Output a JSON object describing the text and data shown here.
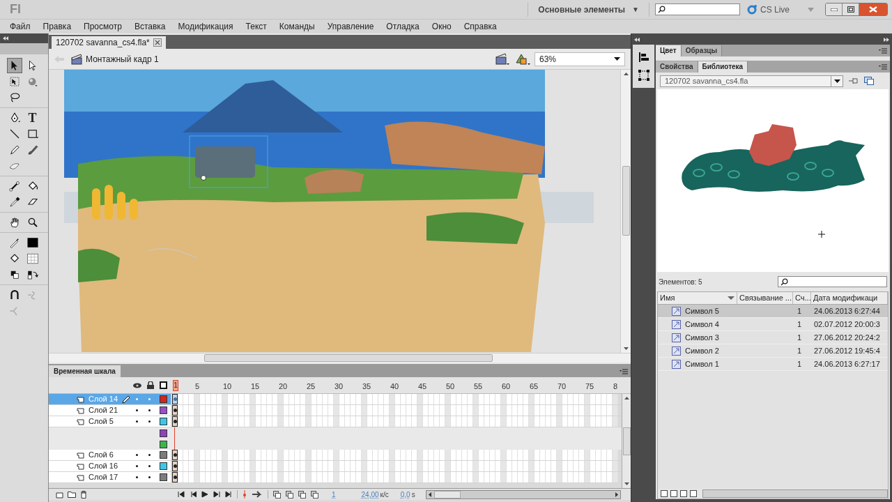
{
  "app": {
    "logo": "Fl",
    "workspace": "Основные элементы",
    "workspace_caret": "▼",
    "cs_live": "CS Live"
  },
  "menu": [
    "Файл",
    "Правка",
    "Просмотр",
    "Вставка",
    "Модификация",
    "Текст",
    "Команды",
    "Управление",
    "Отладка",
    "Окно",
    "Справка"
  ],
  "document": {
    "tab": "120702 savanna_cs4.fla*",
    "scene": "Монтажный кадр 1",
    "zoom": "63%"
  },
  "tool_groups": [
    [
      {
        "kind": "arrow",
        "selected": true
      },
      {
        "kind": "subselect",
        "selected": false
      },
      {
        "kind": "transform",
        "selected": false
      },
      {
        "kind": "rotate3d",
        "selected": false
      },
      {
        "kind": "lasso",
        "selected": false
      }
    ],
    [
      {
        "kind": "pen",
        "selected": false
      },
      {
        "kind": "text",
        "glyph": "T",
        "selected": false
      },
      {
        "kind": "line",
        "selected": false
      },
      {
        "kind": "rect",
        "selected": false
      },
      {
        "kind": "pencil",
        "selected": false
      },
      {
        "kind": "brush",
        "selected": false
      },
      {
        "kind": "deco",
        "selected": false
      }
    ],
    [
      {
        "kind": "bone",
        "selected": false
      },
      {
        "kind": "bucket",
        "selected": false
      },
      {
        "kind": "eyedropper",
        "selected": false
      },
      {
        "kind": "eraser",
        "selected": false
      }
    ],
    [
      {
        "kind": "hand",
        "selected": false
      },
      {
        "kind": "zoom",
        "selected": false
      }
    ],
    [
      {
        "kind": "stroke",
        "selected": false
      },
      {
        "kind": "stroke-swatch",
        "selected": false
      },
      {
        "kind": "fill",
        "selected": false
      },
      {
        "kind": "fill-swatch",
        "selected": false
      },
      {
        "kind": "default-colors",
        "selected": false
      },
      {
        "kind": "swap-colors",
        "selected": false
      }
    ],
    [
      {
        "kind": "snap",
        "selected": false
      },
      {
        "kind": "smooth",
        "selected": false
      },
      {
        "kind": "straighten",
        "selected": false
      }
    ]
  ],
  "timeline": {
    "title": "Временная шкала",
    "ruler": [
      "1",
      "5",
      "10",
      "15",
      "20",
      "25",
      "30",
      "35",
      "40",
      "45",
      "50",
      "55",
      "60",
      "65",
      "70",
      "75",
      "8"
    ],
    "layers": [
      {
        "kind": "layer",
        "name": "Слой 14",
        "selected": true,
        "editing": true,
        "color": "#d0281c",
        "keyframe": true
      },
      {
        "kind": "layer",
        "name": "Слой 21",
        "selected": false,
        "editing": false,
        "color": "#9b4fc4",
        "keyframe": true
      },
      {
        "kind": "layer",
        "name": "Слой 5",
        "selected": false,
        "editing": false,
        "color": "#3fc6e6",
        "keyframe": true
      },
      {
        "kind": "empty",
        "color": "#8e44b8"
      },
      {
        "kind": "empty",
        "color": "#3cb44a"
      },
      {
        "kind": "layer",
        "name": "Слой 6",
        "selected": false,
        "editing": false,
        "color": "#7d7d7d",
        "keyframe": true
      },
      {
        "kind": "layer",
        "name": "Слой 16",
        "selected": false,
        "editing": false,
        "color": "#3fc6e6",
        "keyframe": true
      },
      {
        "kind": "layer",
        "name": "Слой 17",
        "selected": false,
        "editing": false,
        "color": "#7d7d7d",
        "keyframe": true
      }
    ],
    "current_frame": "1",
    "fps": "24,00",
    "fps_unit": "к/с",
    "time": "0,0",
    "time_unit": "s"
  },
  "panels": {
    "top_tabs": [
      {
        "label": "Цвет",
        "selected": true
      },
      {
        "label": "Образцы",
        "selected": false
      }
    ],
    "bottom_tabs": [
      {
        "label": "Свойства",
        "selected": false
      },
      {
        "label": "Библиотека",
        "selected": true
      }
    ]
  },
  "library": {
    "file": "120702 savanna_cs4.fla",
    "count": "Элементов: 5",
    "columns": [
      "Имя",
      "Связывание ...",
      "Сч...",
      "Дата модификаци"
    ],
    "items": [
      {
        "name": "Символ 5",
        "uses": "1",
        "date": "24.06.2013 6:27:44",
        "selected": true
      },
      {
        "name": "Символ 4",
        "uses": "1",
        "date": "02.07.2012 20:00:3",
        "selected": false
      },
      {
        "name": "Символ 3",
        "uses": "1",
        "date": "27.06.2012 20:24:2",
        "selected": false
      },
      {
        "name": "Символ 2",
        "uses": "1",
        "date": "27.06.2012 19:45:4",
        "selected": false
      },
      {
        "name": "Символ 1",
        "uses": "1",
        "date": "24.06.2013 6:27:17",
        "selected": false
      }
    ]
  }
}
